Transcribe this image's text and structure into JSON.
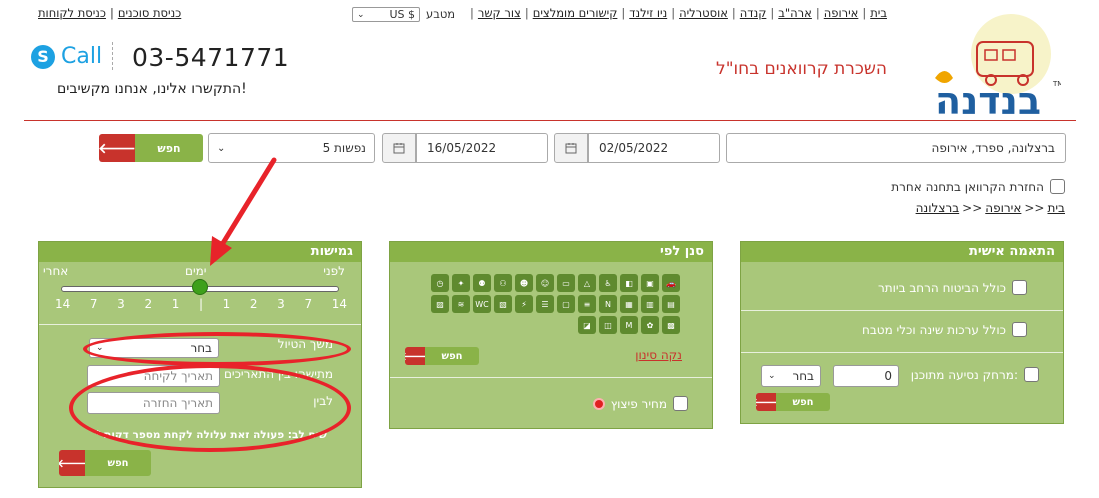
{
  "nav": {
    "links": [
      "בית",
      "אירופה",
      "ארה\"ב",
      "קנדה",
      "אוסטרליה",
      "ניו זילנד",
      "קישורים מומלצים",
      "צור קשר"
    ],
    "currency_label": "מטבע",
    "currency_value": "US $",
    "client_links": [
      "כניסת סוכנים",
      "כניסת לקוחות"
    ]
  },
  "brand": {
    "logo_text": "בנדנה",
    "tagline": "השכרת קרוואנים בחו\"ל"
  },
  "contact": {
    "skype_label": "Call",
    "phone": "03-5471771",
    "text": "התקשרו אלינו, אנחנו מקשיבים!"
  },
  "search": {
    "destination": "ברצלונה, ספרד, אירופה",
    "pickup_date": "02/05/2022",
    "return_date": "16/05/2022",
    "people": "5 נפשות",
    "button": "חפש",
    "other_station": "החזרת הקרוואן בתחנה אחרת"
  },
  "breadcrumb": {
    "home": "בית",
    "region": "אירופה",
    "city": "ברצלונה",
    "sep": ">>"
  },
  "personal": {
    "title": "התאמה אישית",
    "opt_insurance": "כולל הביטוח הרחב ביותר",
    "opt_kits": "כולל ערכות שינה וכלי מטבח",
    "distance_label": "מרחק נסיעה מתוכנן:",
    "distance_value": "0",
    "distance_unit": "בחר",
    "button": "חפש"
  },
  "filter": {
    "title": "סנן לפי",
    "clear": "נקה סינון",
    "button": "חפש",
    "special_price": "מחיר פיצוץ",
    "icons": [
      "car-icon",
      "caravan-icon",
      "camper-icon",
      "wheelchair-icon",
      "tent-icon",
      "bed-icon",
      "family-icon",
      "kids-icon",
      "people-icon",
      "group-icon",
      "shower-icon",
      "clock-icon",
      "bus-icon",
      "van-icon",
      "motorhome-icon",
      "new-icon",
      "bunk-icon",
      "tv-icon",
      "bunk2-icon",
      "power-icon",
      "cargo-icon",
      "wc-icon",
      "shower2-icon",
      "caravan2-icon",
      "camper2-icon",
      "settings-icon",
      "m-icon",
      "caravan3-icon",
      "truck-icon"
    ]
  },
  "flex": {
    "title": "גמישות",
    "before": "לפני",
    "days": "ימים",
    "after": "אחרי",
    "ticks": [
      "14",
      "7",
      "3",
      "2",
      "1",
      "|",
      "1",
      "2",
      "3",
      "7",
      "14"
    ],
    "duration_label": "משך הטיול",
    "duration_value": "בחר",
    "between_label": "מתישהו בין התאריכים",
    "from_placeholder": "תאריך לקיחה",
    "to_label": "לבין",
    "to_placeholder": "תאריך החזרה",
    "note": "* שים לב: פעולה זאת עלולה לקחת מספר דקות",
    "button": "חפש"
  }
}
